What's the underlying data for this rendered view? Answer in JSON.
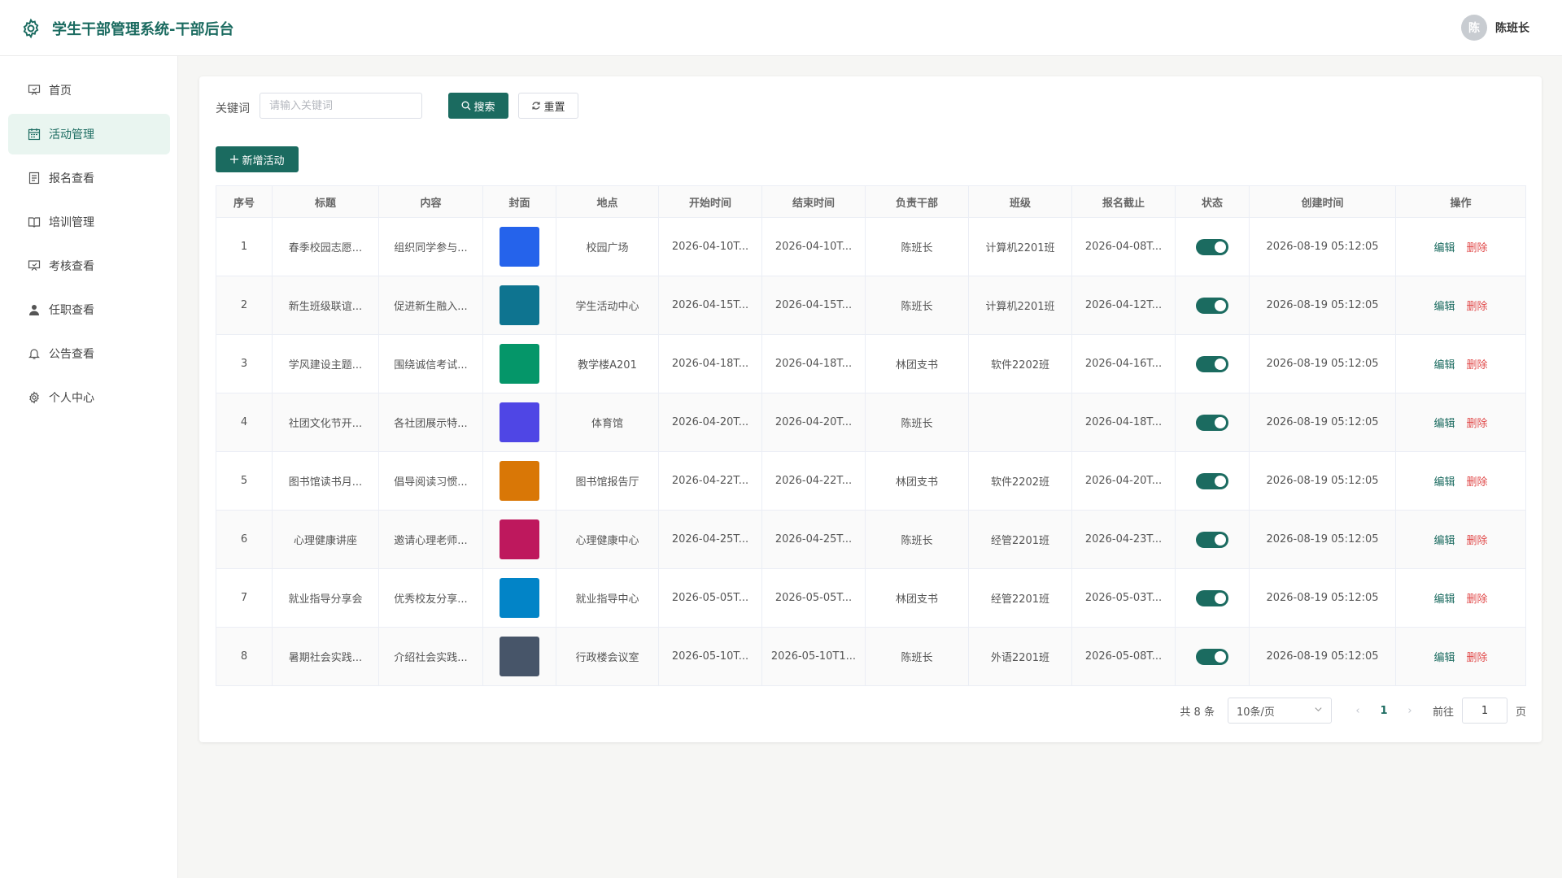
{
  "header": {
    "title": "学生干部管理系统-干部后台",
    "user_avatar_text": "陈",
    "user_name": "陈班长"
  },
  "sidebar": {
    "items": [
      {
        "label": "首页",
        "icon": "presentation-icon",
        "active": false
      },
      {
        "label": "活动管理",
        "icon": "calendar-icon",
        "active": true
      },
      {
        "label": "报名查看",
        "icon": "document-icon",
        "active": false
      },
      {
        "label": "培训管理",
        "icon": "book-icon",
        "active": false
      },
      {
        "label": "考核查看",
        "icon": "presentation-icon",
        "active": false
      },
      {
        "label": "任职查看",
        "icon": "user-icon",
        "active": false
      },
      {
        "label": "公告查看",
        "icon": "bell-icon",
        "active": false
      },
      {
        "label": "个人中心",
        "icon": "gear-icon",
        "active": false
      }
    ]
  },
  "search": {
    "label": "关键词",
    "placeholder": "请输入关键词",
    "value": "",
    "search_button": "搜索",
    "reset_button": "重置"
  },
  "toolbar": {
    "add_button": "新增活动"
  },
  "table": {
    "columns": [
      "序号",
      "标题",
      "内容",
      "封面",
      "地点",
      "开始时间",
      "结束时间",
      "负责干部",
      "班级",
      "报名截止",
      "状态",
      "创建时间",
      "操作"
    ],
    "edit_label": "编辑",
    "delete_label": "删除",
    "rows": [
      {
        "index": "1",
        "title": "春季校园志愿...",
        "content": "组织同学参与...",
        "cover_color": "#2563eb",
        "location": "校园广场",
        "start": "2026-04-10T...",
        "end": "2026-04-10T...",
        "leader": "陈班长",
        "class": "计算机2201班",
        "deadline": "2026-04-08T...",
        "status_on": true,
        "created": "2026-08-19 05:12:05"
      },
      {
        "index": "2",
        "title": "新生班级联谊...",
        "content": "促进新生融入...",
        "cover_color": "#0e7490",
        "location": "学生活动中心",
        "start": "2026-04-15T...",
        "end": "2026-04-15T...",
        "leader": "陈班长",
        "class": "计算机2201班",
        "deadline": "2026-04-12T...",
        "status_on": true,
        "created": "2026-08-19 05:12:05"
      },
      {
        "index": "3",
        "title": "学风建设主题...",
        "content": "围绕诚信考试...",
        "cover_color": "#059669",
        "location": "教学楼A201",
        "start": "2026-04-18T...",
        "end": "2026-04-18T...",
        "leader": "林团支书",
        "class": "软件2202班",
        "deadline": "2026-04-16T...",
        "status_on": true,
        "created": "2026-08-19 05:12:05"
      },
      {
        "index": "4",
        "title": "社团文化节开...",
        "content": "各社团展示特...",
        "cover_color": "#4f46e5",
        "location": "体育馆",
        "start": "2026-04-20T...",
        "end": "2026-04-20T...",
        "leader": "陈班长",
        "class": "",
        "deadline": "2026-04-18T...",
        "status_on": true,
        "created": "2026-08-19 05:12:05"
      },
      {
        "index": "5",
        "title": "图书馆读书月...",
        "content": "倡导阅读习惯...",
        "cover_color": "#d97706",
        "location": "图书馆报告厅",
        "start": "2026-04-22T...",
        "end": "2026-04-22T...",
        "leader": "林团支书",
        "class": "软件2202班",
        "deadline": "2026-04-20T...",
        "status_on": true,
        "created": "2026-08-19 05:12:05"
      },
      {
        "index": "6",
        "title": "心理健康讲座",
        "content": "邀请心理老师...",
        "cover_color": "#be185d",
        "location": "心理健康中心",
        "start": "2026-04-25T...",
        "end": "2026-04-25T...",
        "leader": "陈班长",
        "class": "经管2201班",
        "deadline": "2026-04-23T...",
        "status_on": true,
        "created": "2026-08-19 05:12:05"
      },
      {
        "index": "7",
        "title": "就业指导分享会",
        "content": "优秀校友分享...",
        "cover_color": "#0284c7",
        "location": "就业指导中心",
        "start": "2026-05-05T...",
        "end": "2026-05-05T...",
        "leader": "林团支书",
        "class": "经管2201班",
        "deadline": "2026-05-03T...",
        "status_on": true,
        "created": "2026-08-19 05:12:05"
      },
      {
        "index": "8",
        "title": "暑期社会实践...",
        "content": "介绍社会实践...",
        "cover_color": "#475569",
        "location": "行政楼会议室",
        "start": "2026-05-10T...",
        "end": "2026-05-10T1...",
        "leader": "陈班长",
        "class": "外语2201班",
        "deadline": "2026-05-08T...",
        "status_on": true,
        "created": "2026-08-19 05:12:05"
      }
    ]
  },
  "pagination": {
    "total_text": "共 8 条",
    "page_size": "10条/页",
    "current_page": "1",
    "goto_label": "前往",
    "goto_value": "1",
    "page_suffix": "页"
  },
  "colors": {
    "accent": "#1b6b60",
    "danger": "#e04848",
    "active_bg": "#e9f5f0"
  }
}
